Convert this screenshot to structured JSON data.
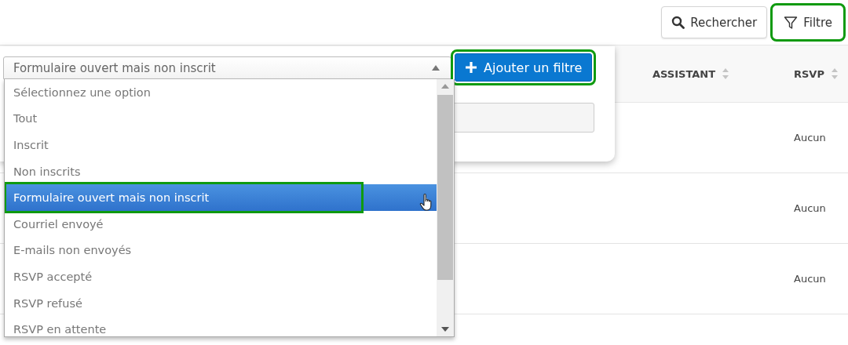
{
  "toolbar": {
    "buttons": [
      {
        "kind": "search",
        "label": "Rechercher",
        "highlighted": false
      },
      {
        "kind": "filter",
        "label": "Filtre",
        "highlighted": true
      }
    ]
  },
  "table": {
    "columns": [
      {
        "label": "ASSISTANT",
        "sortable": true
      },
      {
        "label": "RSVP",
        "sortable": true
      }
    ],
    "rows": [
      {
        "assistant": "",
        "rsvp": "Aucun"
      },
      {
        "assistant": "",
        "rsvp": "Aucun"
      },
      {
        "assistant": "",
        "rsvp": "Aucun"
      }
    ]
  },
  "filter_panel": {
    "select": {
      "value": "Formulaire ouvert mais non inscrit",
      "expanded": true
    },
    "add_button": {
      "label": "Ajouter un filtre",
      "highlighted": true
    },
    "options": [
      {
        "label": "Sélectionnez une option",
        "selected": false,
        "highlighted": false
      },
      {
        "label": "Tout",
        "selected": false,
        "highlighted": false
      },
      {
        "label": "Inscrit",
        "selected": false,
        "highlighted": false
      },
      {
        "label": "Non inscrits",
        "selected": false,
        "highlighted": false
      },
      {
        "label": "Formulaire ouvert mais non inscrit",
        "selected": true,
        "highlighted": true
      },
      {
        "label": "Courriel envoyé",
        "selected": false,
        "highlighted": false
      },
      {
        "label": "E-mails non envoyés",
        "selected": false,
        "highlighted": false
      },
      {
        "label": "RSVP accepté",
        "selected": false,
        "highlighted": false
      },
      {
        "label": "RSVP refusé",
        "selected": false,
        "highlighted": false
      },
      {
        "label": "RSVP en attente",
        "selected": false,
        "highlighted": false
      }
    ]
  }
}
